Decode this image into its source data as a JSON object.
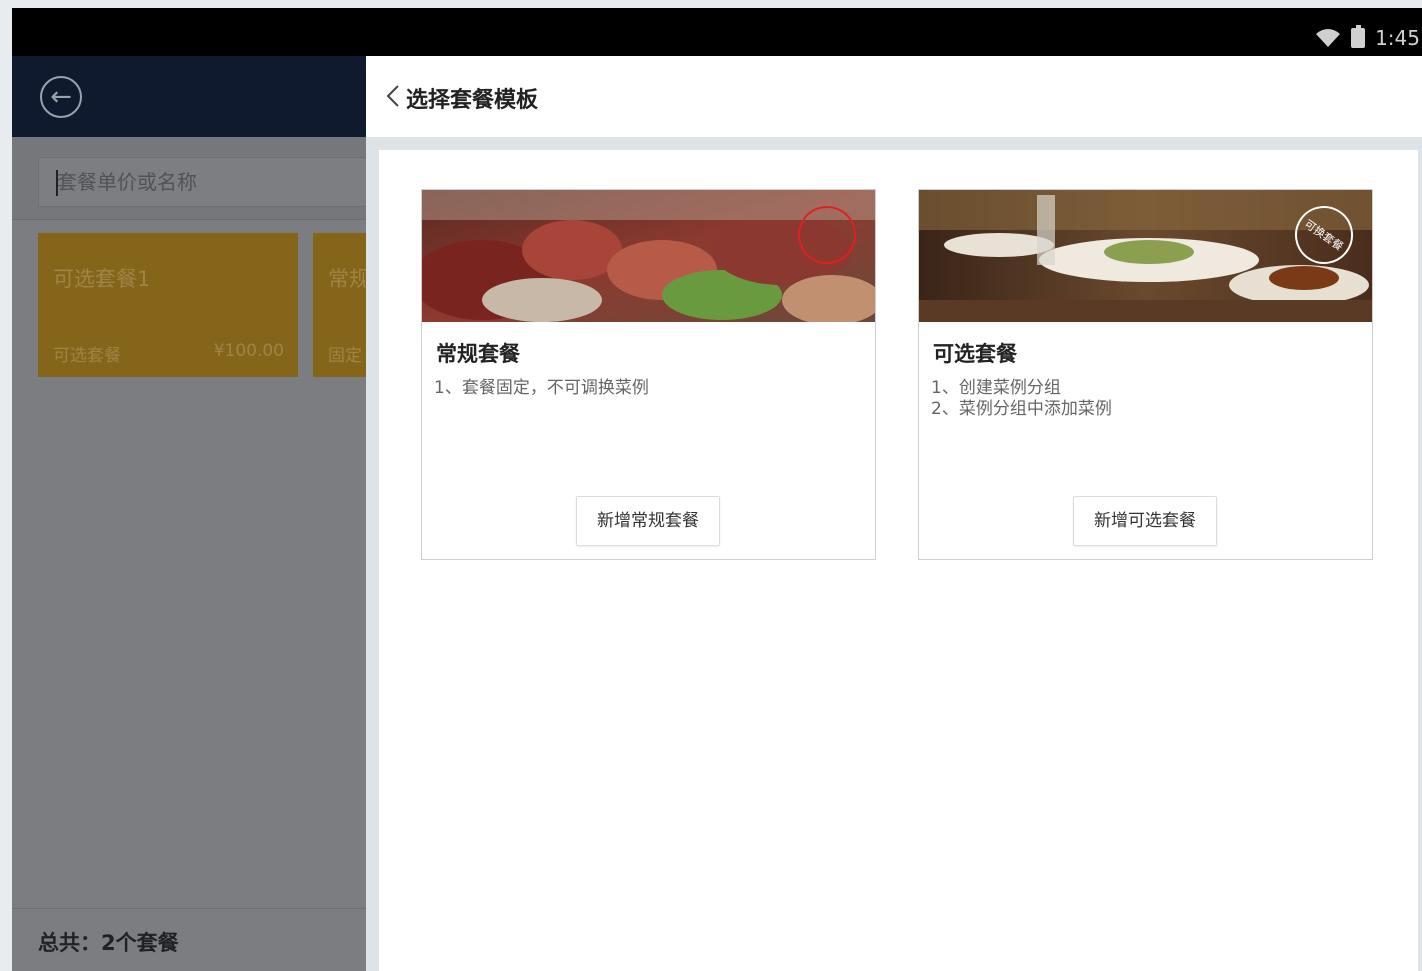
{
  "status_bar": {
    "time": "1:45"
  },
  "left_panel": {
    "search_placeholder": "套餐单价或名称",
    "packages": [
      {
        "name": "可选套餐1",
        "type": "可选套餐",
        "price": "¥100.00"
      },
      {
        "name": "常规",
        "type": "固定"
      }
    ],
    "footer_total": "总共：2个套餐"
  },
  "right_panel": {
    "title": "选择套餐模板",
    "cards": [
      {
        "title": "常规套餐",
        "desc_lines": [
          "1、套餐固定，不可调换菜例"
        ],
        "button": "新增常规套餐",
        "stamp": ""
      },
      {
        "title": "可选套餐",
        "desc_lines": [
          "1、创建菜例分组",
          "2、菜例分组中添加菜例"
        ],
        "button": "新增可选套餐",
        "stamp": "可换套餐"
      }
    ]
  },
  "colors": {
    "package_card_bg": "#84651a",
    "left_header_bg": "#0f1a2e",
    "stamp_red": "#e02020"
  }
}
